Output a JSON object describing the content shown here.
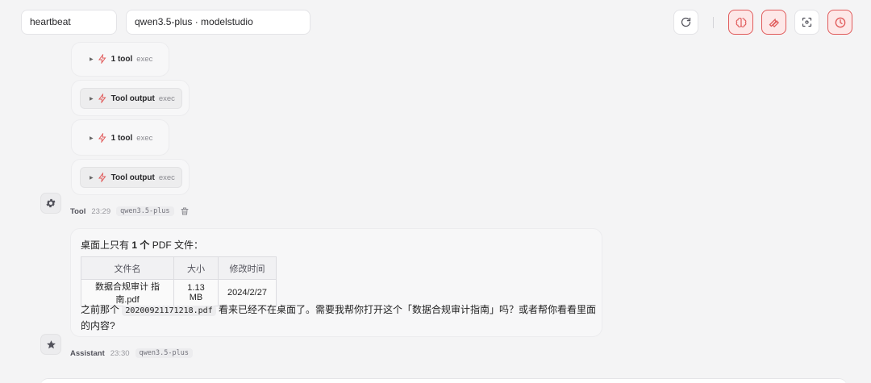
{
  "header": {
    "session": "heartbeat",
    "model": "qwen3.5-plus · modelstudio"
  },
  "icons": {
    "refresh": "refresh-icon",
    "brain": "brain-icon",
    "wrench": "wrench-icon",
    "focus": "focus-icon",
    "clock": "clock-icon",
    "accent": "#e05a5a"
  },
  "tool_blocks": [
    {
      "name": "1 tool",
      "sub": "exec"
    },
    {
      "name": "Tool output",
      "sub": "exec"
    },
    {
      "name": "1 tool",
      "sub": "exec"
    },
    {
      "name": "Tool output",
      "sub": "exec"
    }
  ],
  "tool_meta": {
    "who": "Tool",
    "time": "23:29",
    "model": "qwen3.5-plus"
  },
  "message": {
    "title_pre": "桌面上只有 ",
    "title_bold": "1 个",
    "title_post": " PDF 文件：",
    "table": {
      "headers": [
        "文件名",
        "大小",
        "修改时间"
      ],
      "rows": [
        [
          "数据合规审计 指南.pdf",
          "1.13 MB",
          "2024/2/27"
        ]
      ]
    },
    "text_pre": "之前那个 ",
    "code": "20200921171218.pdf",
    "text_post": " 看来已经不在桌面了。需要我帮你打开这个「数据合规审计指南」吗？或者帮你看看里面的内容?"
  },
  "assistant_meta": {
    "who": "Assistant",
    "time": "23:30",
    "model": "qwen3.5-plus"
  }
}
